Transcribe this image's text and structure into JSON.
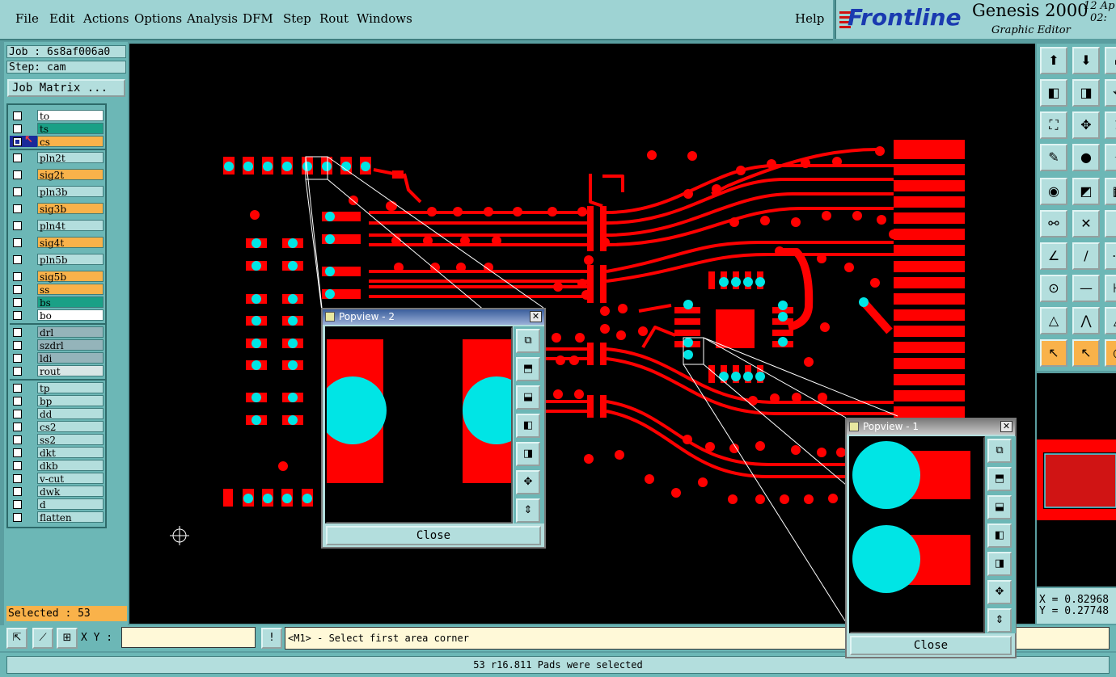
{
  "menu": [
    "File",
    "Edit",
    "Actions",
    "Options",
    "Analysis",
    "DFM",
    "Step",
    "Rout",
    "Windows"
  ],
  "menu_help": "Help",
  "brand": {
    "logo": "Frontline",
    "title": "Genesis 2000",
    "subtitle": "Graphic Editor",
    "date_line1": "12 Ap",
    "date_line2": "02:"
  },
  "job": "Job : 6s8af006a0",
  "step": "Step: cam",
  "job_matrix": "Job Matrix ...",
  "layers": [
    {
      "name": "to",
      "color": "#ffffff",
      "checked": false
    },
    {
      "name": "ts",
      "color": "#1aa086",
      "checked": false
    },
    {
      "name": "cs",
      "color": "#f9b24a",
      "checked": true
    },
    {
      "name": "pln2t",
      "color": "#b3dedd",
      "checked": false
    },
    {
      "name": "sig2t",
      "color": "#f9b24a",
      "checked": false
    },
    {
      "name": "pln3b",
      "color": "#b3dedd",
      "checked": false
    },
    {
      "name": "sig3b",
      "color": "#f9b24a",
      "checked": false
    },
    {
      "name": "pln4t",
      "color": "#b3dedd",
      "checked": false
    },
    {
      "name": "sig4t",
      "color": "#f9b24a",
      "checked": false
    },
    {
      "name": "pln5b",
      "color": "#b3dedd",
      "checked": false
    },
    {
      "name": "sig5b",
      "color": "#f9b24a",
      "checked": false
    },
    {
      "name": "ss",
      "color": "#f9b24a",
      "checked": false
    },
    {
      "name": "bs",
      "color": "#1aa086",
      "checked": false
    },
    {
      "name": "bo",
      "color": "#ffffff",
      "checked": false
    },
    {
      "name": "drl",
      "color": "#94b4ba",
      "checked": false
    },
    {
      "name": "szdrl",
      "color": "#94b4ba",
      "checked": false
    },
    {
      "name": "ldi",
      "color": "#94b4ba",
      "checked": false
    },
    {
      "name": "rout",
      "color": "#d8e6e6",
      "checked": false
    },
    {
      "name": "tp",
      "color": "#b3dedd",
      "checked": false
    },
    {
      "name": "bp",
      "color": "#b3dedd",
      "checked": false
    },
    {
      "name": "dd",
      "color": "#b3dedd",
      "checked": false
    },
    {
      "name": "cs2",
      "color": "#b3dedd",
      "checked": false
    },
    {
      "name": "ss2",
      "color": "#b3dedd",
      "checked": false
    },
    {
      "name": "dkt",
      "color": "#b3dedd",
      "checked": false
    },
    {
      "name": "dkb",
      "color": "#b3dedd",
      "checked": false
    },
    {
      "name": "v-cut",
      "color": "#b3dedd",
      "checked": false
    },
    {
      "name": "dwk",
      "color": "#b3dedd",
      "checked": false
    },
    {
      "name": "d",
      "color": "#b3dedd",
      "checked": false
    },
    {
      "name": "flatten",
      "color": "#b3dedd",
      "checked": false
    }
  ],
  "selected": "Selected : 53",
  "xy_label": "X Y :",
  "xy_value": "",
  "prompt": "<M1> - Select first area corner",
  "status": "53 r16.811 Pads were selected",
  "coords": {
    "x": "X = 0.82968",
    "y": "Y = 0.27748"
  },
  "popview2": {
    "title": "Popview - 2",
    "close": "Close"
  },
  "popview1": {
    "title": "Popview - 1",
    "close": "Close"
  },
  "colors": {
    "copper": "#ff0000",
    "selected_pad": "#00e5e5",
    "background": "#000000"
  }
}
